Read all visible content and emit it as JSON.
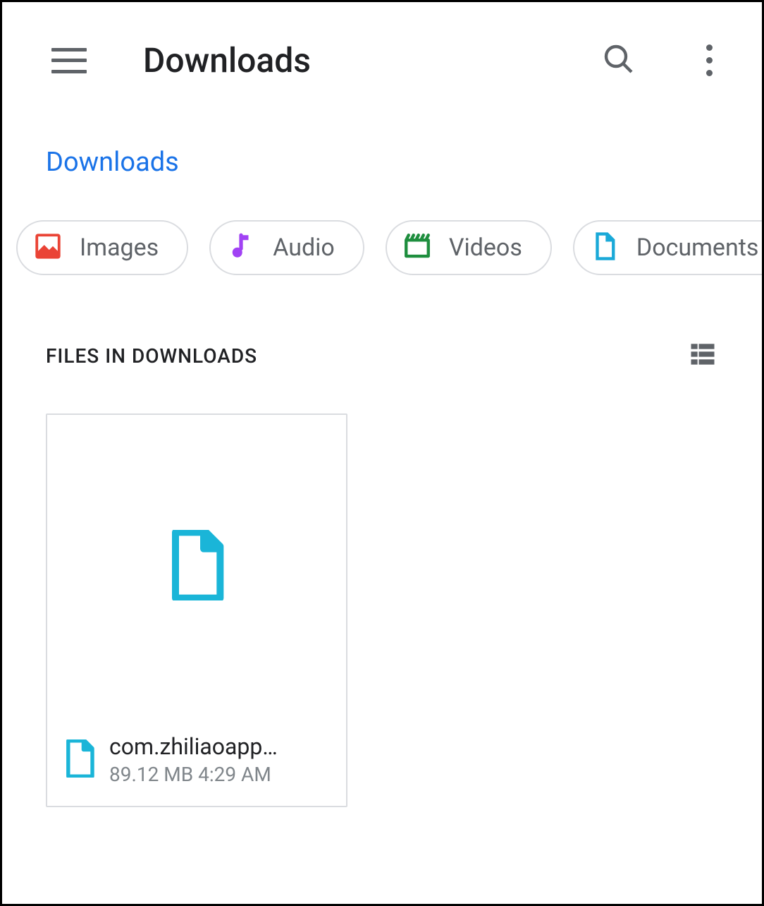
{
  "toolbar": {
    "title": "Downloads"
  },
  "breadcrumb": {
    "current": "Downloads"
  },
  "chips": [
    {
      "label": "Images",
      "icon": "image",
      "color": "#ea4335"
    },
    {
      "label": "Audio",
      "icon": "audio",
      "color": "#a142f4"
    },
    {
      "label": "Videos",
      "icon": "video",
      "color": "#1e8e3e"
    },
    {
      "label": "Documents",
      "icon": "document",
      "color": "#1aa9d8"
    }
  ],
  "section": {
    "title": "FILES IN DOWNLOADS"
  },
  "files": [
    {
      "name": "com.zhiliaoapp…",
      "size": "89.12 MB",
      "time": "4:29 AM"
    }
  ]
}
